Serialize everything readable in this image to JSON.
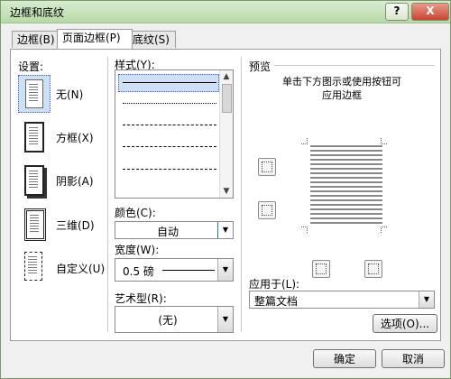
{
  "window": {
    "title": "边框和底纹",
    "help_label": "?",
    "close_label": "X"
  },
  "tabs": [
    {
      "label": "边框(B)"
    },
    {
      "label": "页面边框(P)"
    },
    {
      "label": "底纹(S)"
    }
  ],
  "settings": {
    "heading": "设置:",
    "items": [
      {
        "label": "无(N)"
      },
      {
        "label": "方框(X)"
      },
      {
        "label": "阴影(A)"
      },
      {
        "label": "三维(D)"
      },
      {
        "label": "自定义(U)"
      }
    ]
  },
  "style": {
    "heading": "样式(Y):",
    "color_label": "颜色(C):",
    "color_value": "自动",
    "width_label": "宽度(W):",
    "width_value": "0.5 磅",
    "art_label": "艺术型(R):",
    "art_value": "(无)"
  },
  "preview": {
    "heading": "预览",
    "instruction_line1": "单击下方图示或使用按钮可",
    "instruction_line2": "应用边框",
    "apply_to_label": "应用于(L):",
    "apply_to_value": "整篇文档"
  },
  "buttons": {
    "options": "选项(O)...",
    "ok": "确定",
    "cancel": "取消"
  }
}
